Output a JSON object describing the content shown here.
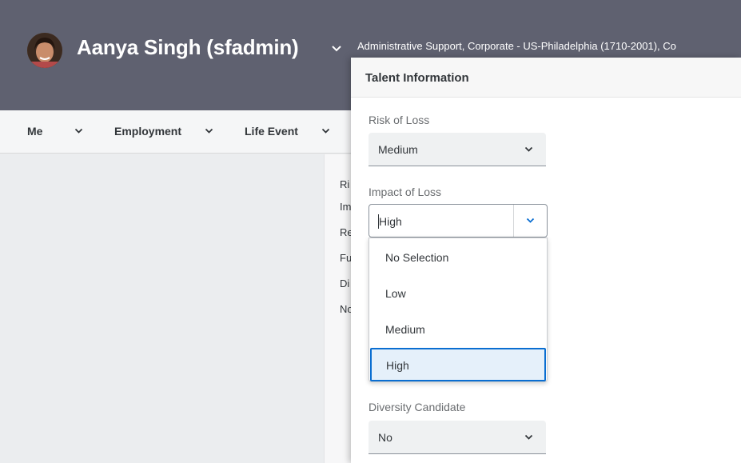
{
  "header": {
    "user_name": "Aanya Singh (sfadmin)",
    "user_subtitle": "Administrative Support, Corporate - US-Philadelphia (1710-2001), Co"
  },
  "nav": {
    "items": [
      {
        "label": "Me"
      },
      {
        "label": "Employment"
      },
      {
        "label": "Life Event"
      }
    ]
  },
  "background_labels": [
    "Ri",
    "Im",
    "Re",
    "Fu",
    "Di",
    "No"
  ],
  "dialog": {
    "title": "Talent Information",
    "risk_of_loss": {
      "label": "Risk of Loss",
      "value": "Medium"
    },
    "impact_of_loss": {
      "label": "Impact of Loss",
      "value": "High",
      "options": [
        "No Selection",
        "Low",
        "Medium",
        "High"
      ],
      "selected_index": 3
    },
    "diversity_candidate": {
      "label": "Diversity Candidate",
      "value": "No"
    }
  },
  "colors": {
    "header_bg": "#5f6170",
    "accent": "#0a6ed1",
    "selected_bg": "#e5f0fa"
  }
}
